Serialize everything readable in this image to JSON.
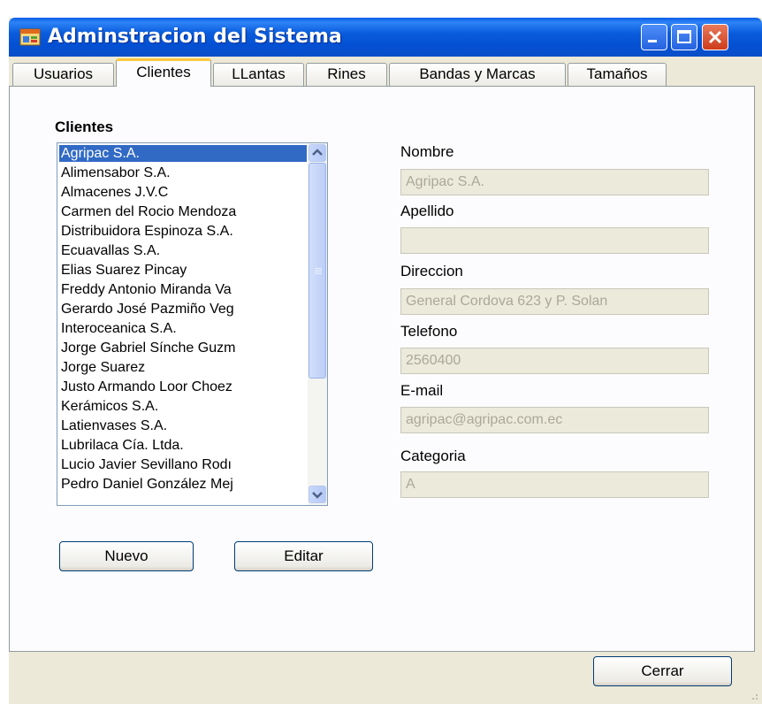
{
  "window": {
    "title": "Adminstracion del Sistema"
  },
  "tabs": [
    {
      "label": "Usuarios",
      "active": false
    },
    {
      "label": "Clientes",
      "active": true
    },
    {
      "label": "LLantas",
      "active": false
    },
    {
      "label": "Rines",
      "active": false
    },
    {
      "label": "Bandas y Marcas",
      "active": false
    },
    {
      "label": "Tamaños",
      "active": false
    }
  ],
  "clientes": {
    "section_title": "Clientes",
    "items": [
      "Agripac S.A.",
      "Alimensabor S.A.",
      "Almacenes J.V.C",
      "Carmen del Rocio Mendoza",
      "Distribuidora Espinoza S.A.",
      "Ecuavallas S.A.",
      "Elias Suarez Pincay",
      "Freddy Antonio Miranda Va",
      "Gerardo José Pazmiño Veg",
      "Interoceanica S.A.",
      "Jorge Gabriel Sínche Guzm",
      "Jorge Suarez",
      "Justo Armando Loor Choez",
      "Kerámicos S.A.",
      "Latienvases S.A.",
      "Lubrilaca Cía. Ltda.",
      "Lucio Javier Sevillano Rodı",
      "Pedro Daniel González Mej"
    ],
    "selected": "Agripac S.A."
  },
  "form": {
    "nombre_label": "Nombre",
    "nombre_value": "Agripac S.A.",
    "apellido_label": "Apellido",
    "apellido_value": "",
    "direccion_label": "Direccion",
    "direccion_value": "General Cordova 623 y P. Solan",
    "telefono_label": "Telefono",
    "telefono_value": "2560400",
    "email_label": "E-mail",
    "email_value": "agripac@agripac.com.ec",
    "categoria_label": "Categoria",
    "categoria_value": "A"
  },
  "buttons": {
    "nuevo": "Nuevo",
    "editar": "Editar",
    "cerrar": "Cerrar"
  },
  "icons": {
    "app": "app-window-icon",
    "minimize": "minimize-icon",
    "maximize": "maximize-icon",
    "close": "close-icon",
    "scroll_up": "chevron-up-icon",
    "scroll_down": "chevron-down-icon"
  },
  "colors": {
    "titlebar": "#0a5cdc",
    "selection": "#316ac5",
    "active_tab_accent": "#ffc83c",
    "disabled_field": "#ebeadb",
    "close_button": "#cd3c1c"
  }
}
